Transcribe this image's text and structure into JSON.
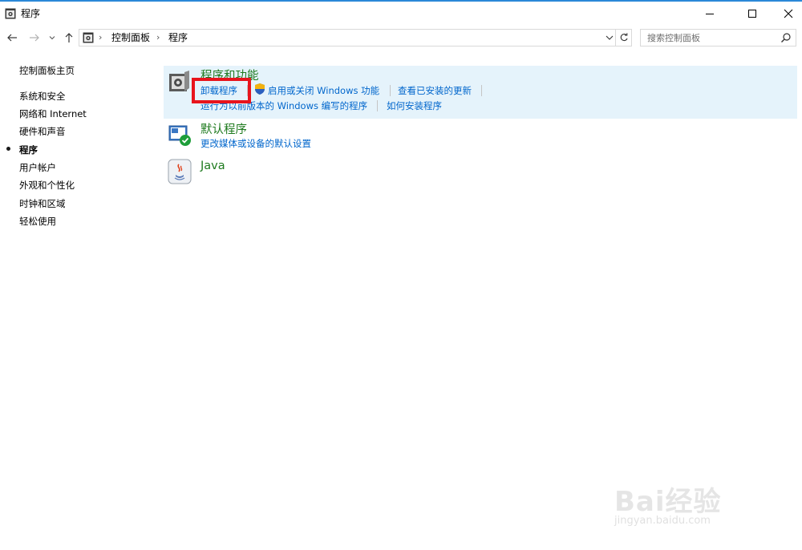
{
  "window": {
    "title": "程序",
    "controls": {
      "minimize": "minimize-icon",
      "maximize": "maximize-icon",
      "close": "close-icon"
    }
  },
  "nav": {
    "breadcrumb": [
      "控制面板",
      "程序"
    ],
    "search_placeholder": "搜索控制面板"
  },
  "sidebar": {
    "home": "控制面板主页",
    "items": [
      {
        "label": "系统和安全",
        "current": false
      },
      {
        "label": "网络和 Internet",
        "current": false
      },
      {
        "label": "硬件和声音",
        "current": false
      },
      {
        "label": "程序",
        "current": true
      },
      {
        "label": "用户帐户",
        "current": false
      },
      {
        "label": "外观和个性化",
        "current": false
      },
      {
        "label": "时钟和区域",
        "current": false
      },
      {
        "label": "轻松使用",
        "current": false
      }
    ]
  },
  "main": {
    "categories": [
      {
        "title": "程序和功能",
        "icon": "programs-features-icon",
        "links": [
          "卸载程序",
          "启用或关闭 Windows 功能",
          "查看已安装的更新",
          "运行为以前版本的 Windows 编写的程序",
          "如何安装程序"
        ]
      },
      {
        "title": "默认程序",
        "icon": "default-programs-icon",
        "links": [
          "更改媒体或设备的默认设置"
        ]
      },
      {
        "title": "Java",
        "icon": "java-icon",
        "links": []
      }
    ]
  },
  "colors": {
    "link": "#0066cc",
    "category_title": "#1e7a1e",
    "highlight_bg": "#e5f3fb",
    "annotation_box": "#e8141c"
  },
  "watermark": {
    "main": "Bai经验",
    "sub": "jingyan.baidu.com"
  }
}
